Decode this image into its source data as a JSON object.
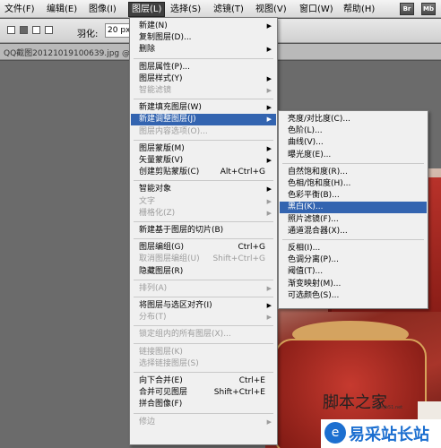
{
  "menubar": {
    "items": [
      "文件(F)",
      "编辑(E)",
      "图像(I)",
      "图层(L)",
      "选择(S)",
      "滤镜(T)",
      "视图(V)",
      "窗口(W)",
      "帮助(H)"
    ],
    "active_index": 3,
    "app_buttons": [
      "Br",
      "Mb"
    ]
  },
  "options": {
    "feather_label": "羽化:",
    "feather_value": "20 px"
  },
  "document_tab": {
    "label": "QQ截图20121019100639.jpg @"
  },
  "layer_menu": {
    "items": [
      {
        "label": "新建(N)",
        "shortcut": "",
        "submenu": true,
        "disabled": false
      },
      {
        "label": "复制图层(D)...",
        "shortcut": "",
        "submenu": false,
        "disabled": false
      },
      {
        "label": "删除",
        "shortcut": "",
        "submenu": true,
        "disabled": false
      },
      {
        "sep": true
      },
      {
        "label": "图层属性(P)...",
        "shortcut": "",
        "submenu": false,
        "disabled": false
      },
      {
        "label": "图层样式(Y)",
        "shortcut": "",
        "submenu": true,
        "disabled": false
      },
      {
        "label": "智能滤镜",
        "shortcut": "",
        "submenu": true,
        "disabled": true
      },
      {
        "sep": true
      },
      {
        "label": "新建填充图层(W)",
        "shortcut": "",
        "submenu": true,
        "disabled": false
      },
      {
        "label": "新建调整图层(J)",
        "shortcut": "",
        "submenu": true,
        "disabled": false,
        "highlight": true
      },
      {
        "label": "图层内容选项(O)...",
        "shortcut": "",
        "submenu": false,
        "disabled": true
      },
      {
        "sep": true
      },
      {
        "label": "图层蒙版(M)",
        "shortcut": "",
        "submenu": true,
        "disabled": false
      },
      {
        "label": "矢量蒙版(V)",
        "shortcut": "",
        "submenu": true,
        "disabled": false
      },
      {
        "label": "创建剪贴蒙版(C)",
        "shortcut": "Alt+Ctrl+G",
        "submenu": false,
        "disabled": false
      },
      {
        "sep": true
      },
      {
        "label": "智能对象",
        "shortcut": "",
        "submenu": true,
        "disabled": false
      },
      {
        "label": "文字",
        "shortcut": "",
        "submenu": true,
        "disabled": true
      },
      {
        "label": "栅格化(Z)",
        "shortcut": "",
        "submenu": true,
        "disabled": true
      },
      {
        "sep": true
      },
      {
        "label": "新建基于图层的切片(B)",
        "shortcut": "",
        "submenu": false,
        "disabled": false
      },
      {
        "sep": true
      },
      {
        "label": "图层编组(G)",
        "shortcut": "Ctrl+G",
        "submenu": false,
        "disabled": false
      },
      {
        "label": "取消图层编组(U)",
        "shortcut": "Shift+Ctrl+G",
        "submenu": false,
        "disabled": true
      },
      {
        "label": "隐藏图层(R)",
        "shortcut": "",
        "submenu": false,
        "disabled": false
      },
      {
        "sep": true
      },
      {
        "label": "排列(A)",
        "shortcut": "",
        "submenu": true,
        "disabled": true
      },
      {
        "sep": true
      },
      {
        "label": "将图层与选区对齐(I)",
        "shortcut": "",
        "submenu": true,
        "disabled": false
      },
      {
        "label": "分布(T)",
        "shortcut": "",
        "submenu": true,
        "disabled": true
      },
      {
        "sep": true
      },
      {
        "label": "锁定组内的所有图层(X)...",
        "shortcut": "",
        "submenu": false,
        "disabled": true
      },
      {
        "sep": true
      },
      {
        "label": "链接图层(K)",
        "shortcut": "",
        "submenu": false,
        "disabled": true
      },
      {
        "label": "选择链接图层(S)",
        "shortcut": "",
        "submenu": false,
        "disabled": true
      },
      {
        "sep": true
      },
      {
        "label": "向下合并(E)",
        "shortcut": "Ctrl+E",
        "submenu": false,
        "disabled": false
      },
      {
        "label": "合并可见图层",
        "shortcut": "Shift+Ctrl+E",
        "submenu": false,
        "disabled": false
      },
      {
        "label": "拼合图像(F)",
        "shortcut": "",
        "submenu": false,
        "disabled": false
      },
      {
        "sep": true
      },
      {
        "label": "修边",
        "shortcut": "",
        "submenu": true,
        "disabled": true
      }
    ]
  },
  "adjustment_submenu": {
    "items": [
      {
        "label": "亮度/对比度(C)..."
      },
      {
        "label": "色阶(L)..."
      },
      {
        "label": "曲线(V)..."
      },
      {
        "label": "曝光度(E)..."
      },
      {
        "sep": true
      },
      {
        "label": "自然饱和度(R)..."
      },
      {
        "label": "色相/饱和度(H)..."
      },
      {
        "label": "色彩平衡(B)..."
      },
      {
        "label": "黑白(K)...",
        "highlight": true
      },
      {
        "label": "照片滤镜(F)..."
      },
      {
        "label": "通道混合器(X)..."
      },
      {
        "sep": true
      },
      {
        "label": "反相(I)..."
      },
      {
        "label": "色调分离(P)..."
      },
      {
        "label": "阈值(T)..."
      },
      {
        "label": "渐变映射(M)..."
      },
      {
        "label": "可选颜色(S)..."
      }
    ]
  },
  "watermark": {
    "text": "脚本之家",
    "sub": "www.jb51.net",
    "logo_text": "易采站长站"
  },
  "colors": {
    "highlight": "#3364b0",
    "menu_bg": "#f0f0f0",
    "disabled": "#9d9d9d"
  }
}
